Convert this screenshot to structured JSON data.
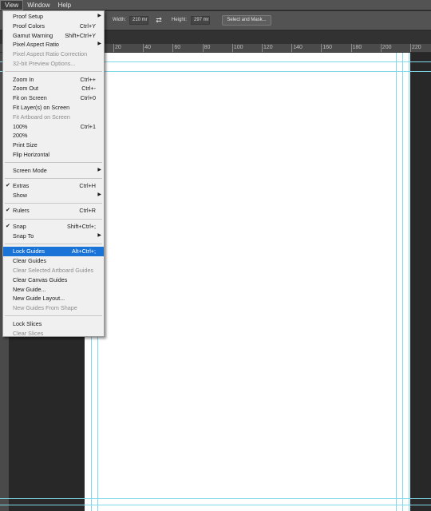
{
  "menubar": [
    {
      "label": "View",
      "active": true
    },
    {
      "label": "Window",
      "active": false
    },
    {
      "label": "Help",
      "active": false
    }
  ],
  "options": {
    "width_label": "Width:",
    "width_value": "210 mr",
    "height_label": "Height:",
    "height_value": "297 mr",
    "select_mask": "Select and Mask..."
  },
  "ruler_top": [
    "20",
    "40",
    "60",
    "80",
    "100",
    "120",
    "140",
    "160",
    "180",
    "200",
    "220"
  ],
  "view_menu": {
    "items": [
      {
        "label": "Proof Setup",
        "submenu": true
      },
      {
        "label": "Proof Colors",
        "shortcut": "Ctrl+Y"
      },
      {
        "label": "Gamut Warning",
        "shortcut": "Shift+Ctrl+Y"
      },
      {
        "label": "Pixel Aspect Ratio",
        "submenu": true
      },
      {
        "label": "Pixel Aspect Ratio Correction",
        "disabled": true
      },
      {
        "label": "32-bit Preview Options...",
        "disabled": true
      },
      {
        "separator": true
      },
      {
        "label": "Zoom In",
        "shortcut": "Ctrl++"
      },
      {
        "label": "Zoom Out",
        "shortcut": "Ctrl+-"
      },
      {
        "label": "Fit on Screen",
        "shortcut": "Ctrl+0"
      },
      {
        "label": "Fit Layer(s) on Screen"
      },
      {
        "label": "Fit Artboard on Screen",
        "disabled": true
      },
      {
        "label": "100%",
        "shortcut": "Ctrl+1"
      },
      {
        "label": "200%"
      },
      {
        "label": "Print Size"
      },
      {
        "label": "Flip Horizontal"
      },
      {
        "separator": true
      },
      {
        "label": "Screen Mode",
        "submenu": true
      },
      {
        "separator": true
      },
      {
        "label": "Extras",
        "shortcut": "Ctrl+H",
        "checked": true
      },
      {
        "label": "Show",
        "submenu": true
      },
      {
        "separator": true
      },
      {
        "label": "Rulers",
        "shortcut": "Ctrl+R",
        "checked": true
      },
      {
        "separator": true
      },
      {
        "label": "Snap",
        "shortcut": "Shift+Ctrl+;",
        "checked": true
      },
      {
        "label": "Snap To",
        "submenu": true
      },
      {
        "separator": true
      },
      {
        "label": "Lock Guides",
        "shortcut": "Alt+Ctrl+;",
        "highlighted": true
      },
      {
        "label": "Clear Guides"
      },
      {
        "label": "Clear Selected Artboard Guides",
        "disabled": true
      },
      {
        "label": "Clear Canvas Guides"
      },
      {
        "label": "New Guide..."
      },
      {
        "label": "New Guide Layout..."
      },
      {
        "label": "New Guides From Shape",
        "disabled": true
      },
      {
        "separator": true
      },
      {
        "label": "Lock Slices"
      },
      {
        "label": "Clear Slices",
        "disabled": true
      }
    ]
  },
  "colors": {
    "menu_bg": "#f0f0f0",
    "highlight": "#1a74d8",
    "guide": "#7fd8e8",
    "workspace": "#282828"
  }
}
